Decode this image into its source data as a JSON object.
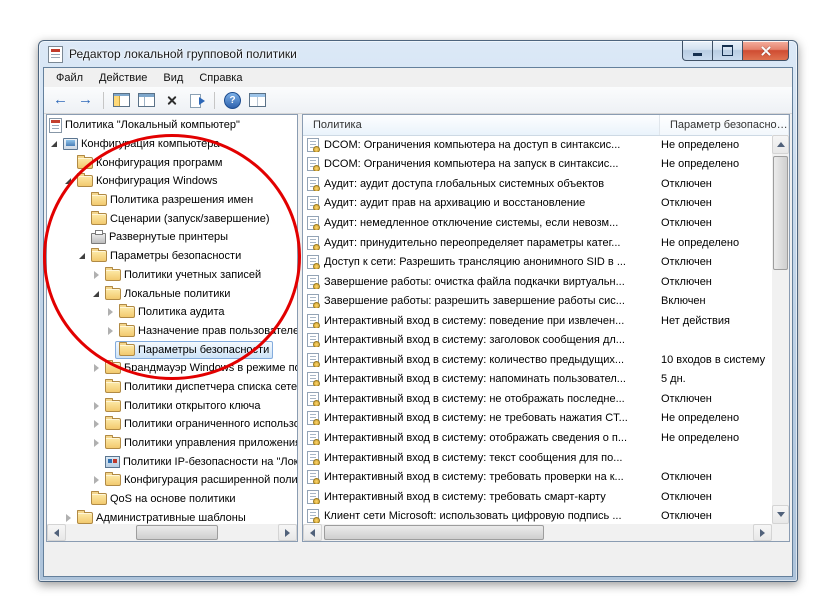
{
  "window": {
    "title": "Редактор локальной групповой политики",
    "controls": [
      {
        "name": "minimize-button",
        "icon": "minimize"
      },
      {
        "name": "maximize-button",
        "icon": "maximize"
      },
      {
        "name": "close-button",
        "icon": "close"
      }
    ]
  },
  "menubar": {
    "items": [
      "Файл",
      "Действие",
      "Вид",
      "Справка"
    ]
  },
  "toolbar": {
    "items": [
      {
        "type": "button",
        "name": "back-button",
        "icon": "back"
      },
      {
        "type": "button",
        "name": "forward-button",
        "icon": "forward"
      },
      {
        "type": "sep"
      },
      {
        "type": "button",
        "name": "show-console-tree-button",
        "icon": "showtree"
      },
      {
        "type": "button",
        "name": "window-panes-button",
        "icon": "panes"
      },
      {
        "type": "button",
        "name": "delete-button",
        "icon": "delete"
      },
      {
        "type": "button",
        "name": "export-list-button",
        "icon": "export"
      },
      {
        "type": "sep"
      },
      {
        "type": "button",
        "name": "help-button",
        "icon": "help"
      },
      {
        "type": "button",
        "name": "properties-table-button",
        "icon": "table"
      }
    ]
  },
  "tree": {
    "items": [
      {
        "label": "Политика \"Локальный компьютер\"",
        "level": 0,
        "arrow": null,
        "icon": "console",
        "selected": false
      },
      {
        "label": "Конфигурация компьютера",
        "level": 1,
        "arrow": "expanded",
        "icon": "computer",
        "selected": false
      },
      {
        "label": "Конфигурация программ",
        "level": 2,
        "arrow": null,
        "icon": "folder",
        "selected": false
      },
      {
        "label": "Конфигурация Windows",
        "level": 2,
        "arrow": "expanded",
        "icon": "folder",
        "selected": false
      },
      {
        "label": "Политика разрешения имен",
        "level": 3,
        "arrow": null,
        "icon": "folder",
        "selected": false
      },
      {
        "label": "Сценарии (запуск/завершение)",
        "level": 3,
        "arrow": null,
        "icon": "folder",
        "selected": false
      },
      {
        "label": "Развернутые принтеры",
        "level": 3,
        "arrow": null,
        "icon": "printer",
        "selected": false
      },
      {
        "label": "Параметры безопасности",
        "level": 3,
        "arrow": "expanded",
        "icon": "folder",
        "selected": false
      },
      {
        "label": "Политики учетных записей",
        "level": 4,
        "arrow": "collapsed",
        "icon": "folder",
        "selected": false
      },
      {
        "label": "Локальные политики",
        "level": 4,
        "arrow": "expanded",
        "icon": "folder",
        "selected": false
      },
      {
        "label": "Политика аудита",
        "level": 5,
        "arrow": "collapsed",
        "icon": "folder",
        "selected": false
      },
      {
        "label": "Назначение прав пользователей",
        "level": 5,
        "arrow": "collapsed",
        "icon": "folder",
        "selected": false
      },
      {
        "label": "Параметры безопасности",
        "level": 5,
        "arrow": null,
        "icon": "folder",
        "selected": true
      },
      {
        "label": "Брандмауэр Windows в режиме повышенной безопасности",
        "level": 4,
        "arrow": "collapsed",
        "icon": "folder",
        "selected": false
      },
      {
        "label": "Политики диспетчера списка сетей",
        "level": 4,
        "arrow": null,
        "icon": "folder",
        "selected": false
      },
      {
        "label": "Политики открытого ключа",
        "level": 4,
        "arrow": "collapsed",
        "icon": "folder",
        "selected": false
      },
      {
        "label": "Политики ограниченного использования программ",
        "level": 4,
        "arrow": "collapsed",
        "icon": "folder",
        "selected": false
      },
      {
        "label": "Политики управления приложениями",
        "level": 4,
        "arrow": "collapsed",
        "icon": "folder",
        "selected": false
      },
      {
        "label": "Политики IP-безопасности на \"Локальный компьютер\"",
        "level": 4,
        "arrow": null,
        "icon": "ip",
        "selected": false
      },
      {
        "label": "Конфигурация расширенной политики аудита",
        "level": 4,
        "arrow": "collapsed",
        "icon": "folder",
        "selected": false
      },
      {
        "label": "QoS на основе политики",
        "level": 3,
        "arrow": null,
        "icon": "folder",
        "selected": false
      },
      {
        "label": "Административные шаблоны",
        "level": 2,
        "arrow": "collapsed",
        "icon": "folder",
        "selected": false
      }
    ]
  },
  "list": {
    "columns": [
      {
        "label": "Политика"
      },
      {
        "label": "Параметр безопасности"
      }
    ],
    "rows": [
      {
        "name": "DCOM: Ограничения компьютера на доступ в синтаксис...",
        "value": "Не определено"
      },
      {
        "name": "DCOM: Ограничения компьютера на запуск в синтаксис...",
        "value": "Не определено"
      },
      {
        "name": "Аудит: аудит доступа глобальных системных объектов",
        "value": "Отключен"
      },
      {
        "name": "Аудит: аудит прав на архивацию и восстановление",
        "value": "Отключен"
      },
      {
        "name": "Аудит: немедленное отключение системы, если невозм...",
        "value": "Отключен"
      },
      {
        "name": "Аудит: принудительно переопределяет параметры катег...",
        "value": "Не определено"
      },
      {
        "name": "Доступ к сети: Разрешить трансляцию анонимного SID в ...",
        "value": "Отключен"
      },
      {
        "name": "Завершение работы: очистка файла подкачки виртуальн...",
        "value": "Отключен"
      },
      {
        "name": "Завершение работы: разрешить завершение работы сис...",
        "value": "Включен"
      },
      {
        "name": "Интерактивный вход в систему:  поведение при извлечен...",
        "value": "Нет действия"
      },
      {
        "name": "Интерактивный вход в систему: заголовок сообщения дл...",
        "value": ""
      },
      {
        "name": "Интерактивный вход в систему: количество предыдущих...",
        "value": "10 входов в систему"
      },
      {
        "name": "Интерактивный вход в систему: напоминать пользовател...",
        "value": "5 дн."
      },
      {
        "name": "Интерактивный вход в систему: не отображать последне...",
        "value": "Отключен"
      },
      {
        "name": "Интерактивный вход в систему: не требовать нажатия CT...",
        "value": "Не определено"
      },
      {
        "name": "Интерактивный вход в систему: отображать сведения о п...",
        "value": "Не определено"
      },
      {
        "name": "Интерактивный вход в систему: текст сообщения для по...",
        "value": ""
      },
      {
        "name": "Интерактивный вход в систему: требовать проверки на к...",
        "value": "Отключен"
      },
      {
        "name": "Интерактивный вход в систему: требовать смарт-карту",
        "value": "Отключен"
      },
      {
        "name": "Клиент сети Microsoft: использовать цифровую подпись ...",
        "value": "Отключен"
      }
    ]
  },
  "annotation": {
    "shape": "oval",
    "color": "#e20000"
  },
  "colors": {
    "selection_border": "#84acdd",
    "selection_fill": "#cde3f7",
    "close_button_red": "#cf4c32",
    "toolbar_blue": "#2c67b8"
  }
}
